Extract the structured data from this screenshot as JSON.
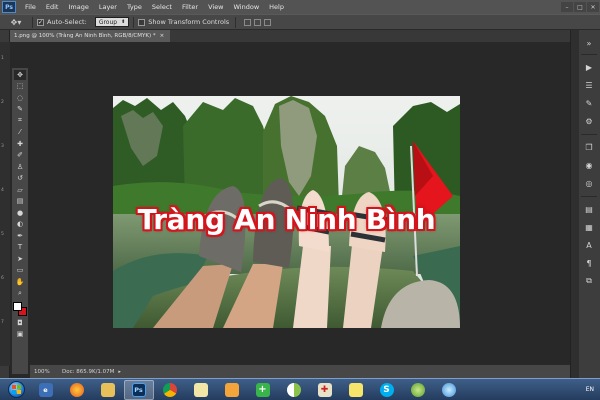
{
  "app": {
    "logo": "Ps"
  },
  "menu": [
    "File",
    "Edit",
    "Image",
    "Layer",
    "Type",
    "Select",
    "Filter",
    "View",
    "Window",
    "Help"
  ],
  "window_controls": [
    "minimize-icon",
    "maximize-icon",
    "close-icon"
  ],
  "options": {
    "auto_select_label": "Auto-Select:",
    "auto_select_value": "Group",
    "transform_label": "Show Transform Controls"
  },
  "document": {
    "tab_title": "1.png @ 100% (Tràng An Ninh Bình, RGB/8/CMYK) *",
    "headline": "Tràng An Ninh Bình"
  },
  "status": {
    "zoom": "100%",
    "doc": "Doc: 865.9K/1.07M"
  },
  "ruler_ticks": [
    "1",
    "2",
    "3",
    "4",
    "5",
    "6",
    "7"
  ],
  "tools": [
    "move-tool",
    "marquee-tool",
    "lasso-tool",
    "quick-select-tool",
    "crop-tool",
    "eyedropper-tool",
    "healing-tool",
    "brush-tool",
    "clone-stamp-tool",
    "history-brush-tool",
    "eraser-tool",
    "gradient-tool",
    "blur-tool",
    "dodge-tool",
    "pen-tool",
    "type-tool",
    "path-select-tool",
    "shape-tool",
    "hand-tool",
    "zoom-tool"
  ],
  "colors": {
    "foreground": "#ffffff",
    "background": "#d7131f",
    "accent": "#d4141c"
  },
  "taskbar": {
    "apps": [
      "explorer",
      "firefox",
      "explorer-folder",
      "photoshop",
      "chrome",
      "paint",
      "outlook",
      "solitaire",
      "chrome-alt",
      "calculator",
      "sticky-notes",
      "skype",
      "app-green",
      "app-blue"
    ],
    "language": "EN"
  }
}
